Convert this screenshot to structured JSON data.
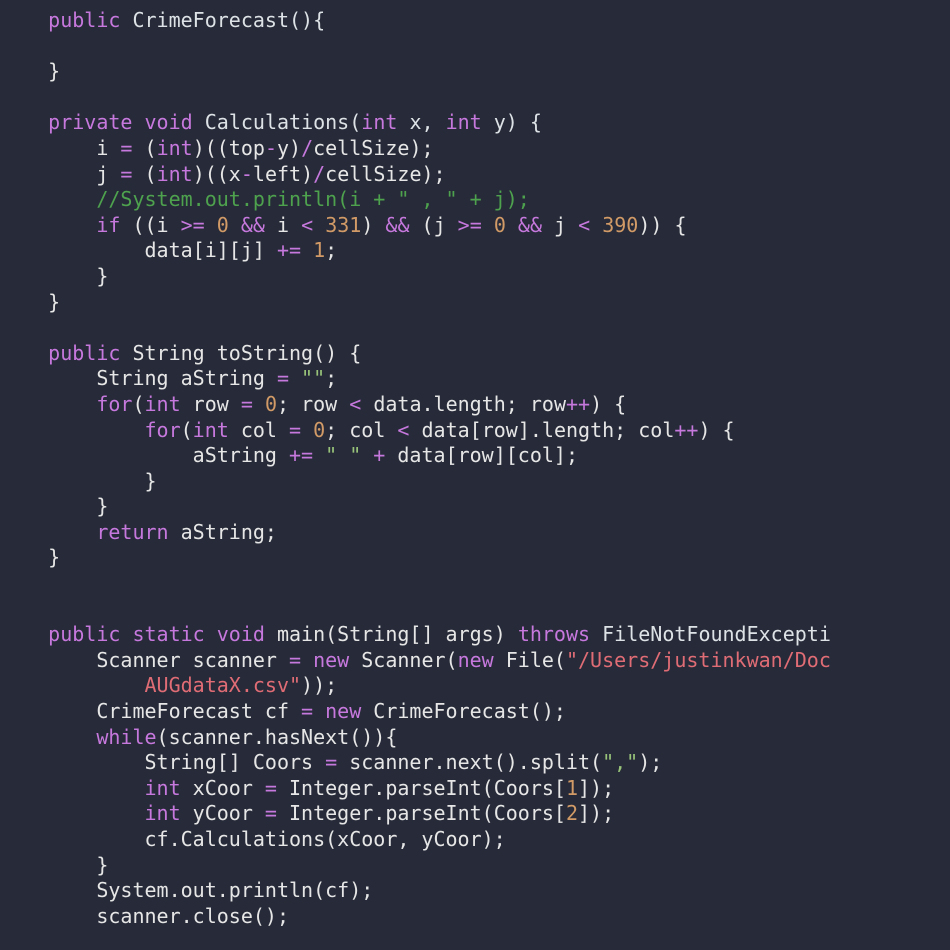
{
  "code": {
    "line1": "    public CrimeForecast(){",
    "line2": "",
    "line3": "    }",
    "line4": "",
    "line5": "    private void Calculations(int x, int y) {",
    "line6": "        i = (int)((top-y)/cellSize);",
    "line7": "        j = (int)((x-left)/cellSize);",
    "line8": "        //System.out.println(i + \" , \" + j);",
    "line9": "        if ((i >= 0 && i < 331) && (j >= 0 && j < 390)) {",
    "line10": "            data[i][j] += 1;",
    "line11": "        }",
    "line12": "    }",
    "line13": "",
    "line14": "    public String toString() {",
    "line15": "        String aString = \"\";",
    "line16": "        for(int row = 0; row < data.length; row++) {",
    "line17": "            for(int col = 0; col < data[row].length; col++) {",
    "line18": "                aString += \" \" + data[row][col];",
    "line19": "            }",
    "line20": "        }",
    "line21": "        return aString;",
    "line22": "    }",
    "line23": "",
    "line24": "",
    "line25": "    public static void main(String[] args) throws FileNotFoundExcepti",
    "line26": "        Scanner scanner = new Scanner(new File(\"/Users/justinkwan/Doc",
    "line27": "            AUGdataX.csv\"));",
    "line28": "        CrimeForecast cf = new CrimeForecast();",
    "line29": "        while(scanner.hasNext()){",
    "line30": "            String[] Coors = scanner.next().split(\",\");",
    "line31": "            int xCoor = Integer.parseInt(Coors[1]);",
    "line32": "            int yCoor = Integer.parseInt(Coors[2]);",
    "line33": "            cf.Calculations(xCoor, yCoor);",
    "line34": "        }",
    "line35": "        System.out.println(cf);",
    "line36": "        scanner.close();"
  },
  "tokens": {
    "public": "public",
    "private": "private",
    "void": "void",
    "int": "int",
    "if": "if",
    "for": "for",
    "return": "return",
    "static": "static",
    "throws": "throws",
    "new": "new",
    "while": "while",
    "String": "String",
    "Scanner": "Scanner",
    "Integer": "Integer",
    "File": "File",
    "CrimeForecast": "CrimeForecast",
    "Calculations": "Calculations",
    "toString": "toString",
    "main": "main",
    "FileNotFoundExcepti": "FileNotFoundExcepti",
    "num0": "0",
    "num1": "1",
    "num2": "2",
    "num331": "331",
    "num390": "390",
    "str_empty": "\"\"",
    "str_space": "\" \"",
    "str_comma": "\",\"",
    "str_path": "\"/Users/justinkwan/Doc",
    "str_path2": "AUGdataX.csv\"",
    "comment": "//System.out.println(i + \" , \" + j);"
  },
  "colors": {
    "bg": "#272b39",
    "fg": "#e6e6e6",
    "keyword": "#c678dd",
    "number": "#d19a66",
    "string": "#98c379",
    "comment": "#4ea24e",
    "error": "#e06c75"
  }
}
